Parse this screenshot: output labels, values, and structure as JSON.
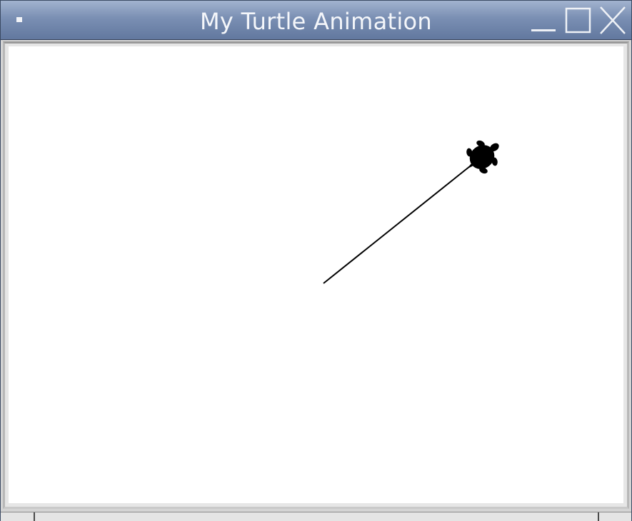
{
  "window": {
    "title": "My Turtle Animation"
  },
  "titlebar": {
    "menu_icon": "window-menu-icon",
    "controls": [
      "minimize-icon",
      "maximize-icon",
      "close-icon"
    ]
  },
  "canvas": {
    "background": "#ffffff",
    "pen_color": "#000000",
    "turtle_color": "#000000",
    "turtle_shape": "turtle-icon"
  }
}
